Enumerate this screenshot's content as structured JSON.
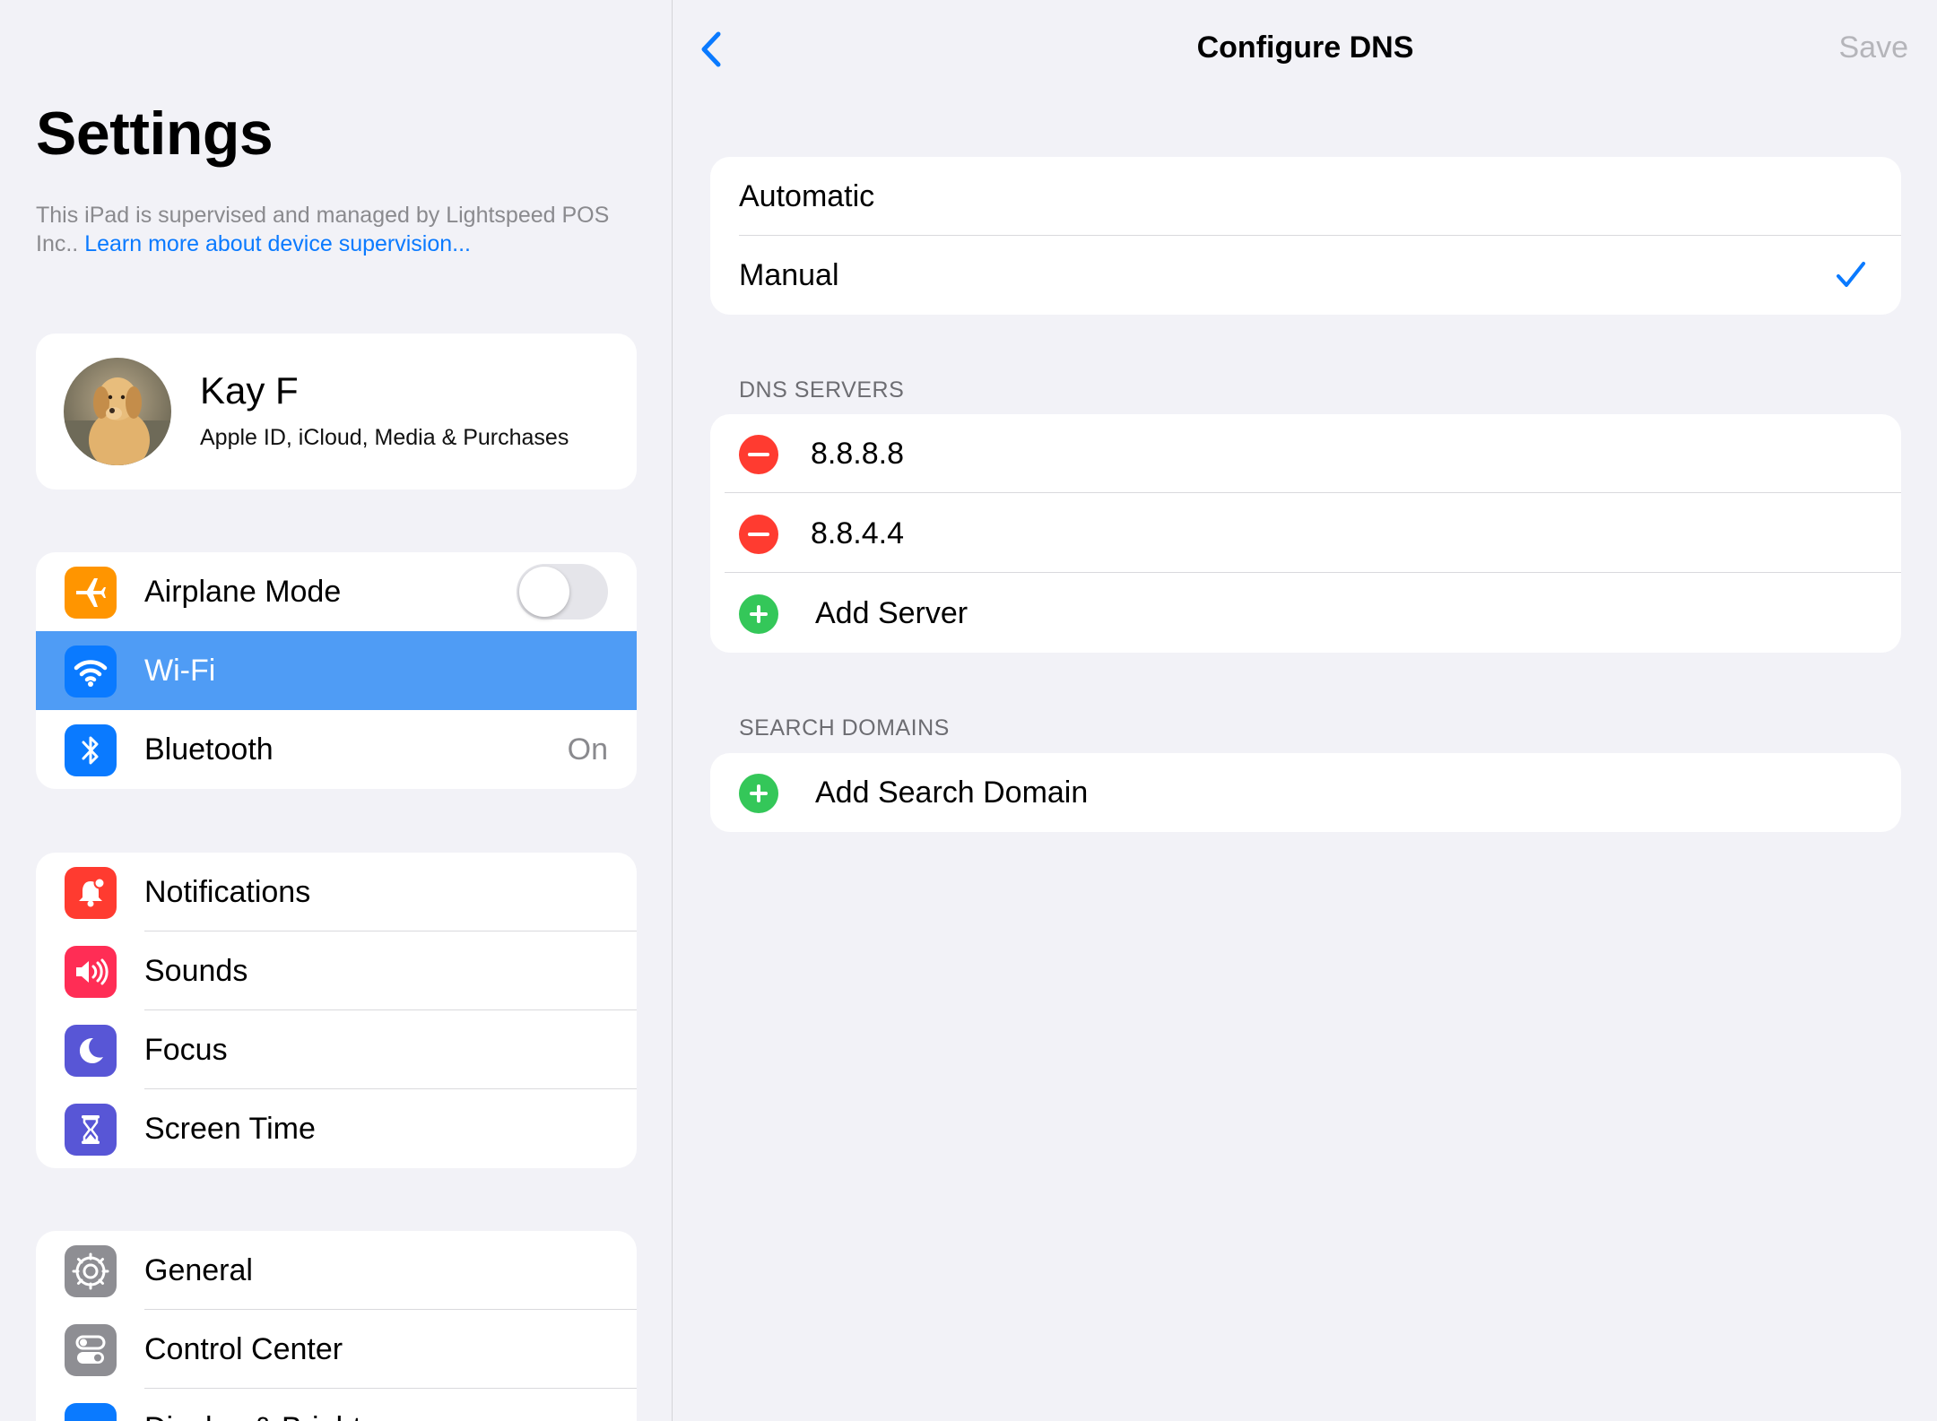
{
  "sidebar": {
    "title": "Settings",
    "supervision_text": "This iPad is supervised and managed by Lightspeed POS Inc..",
    "supervision_link": "Learn more about device supervision...",
    "profile": {
      "name": "Kay F",
      "subtitle": "Apple ID, iCloud, Media & Purchases"
    },
    "group1": [
      {
        "label": "Airplane Mode",
        "icon": "airplane-icon",
        "color": "#ff9500",
        "toggle": false
      },
      {
        "label": "Wi-Fi",
        "icon": "wifi-icon",
        "color": "#0a7aff",
        "selected": true
      },
      {
        "label": "Bluetooth",
        "icon": "bluetooth-icon",
        "color": "#0a7aff",
        "value": "On"
      }
    ],
    "group2": [
      {
        "label": "Notifications",
        "icon": "bell-icon",
        "color": "#ff3b30"
      },
      {
        "label": "Sounds",
        "icon": "speaker-icon",
        "color": "#ff2d55"
      },
      {
        "label": "Focus",
        "icon": "moon-icon",
        "color": "#5856d6"
      },
      {
        "label": "Screen Time",
        "icon": "hourglass-icon",
        "color": "#5856d6"
      }
    ],
    "group3": [
      {
        "label": "General",
        "icon": "gear-icon",
        "color": "#8e8e93"
      },
      {
        "label": "Control Center",
        "icon": "switches-icon",
        "color": "#8e8e93"
      },
      {
        "label": "Display & Brightness",
        "icon": "display-icon",
        "color": "#0a7aff"
      }
    ]
  },
  "detail": {
    "title": "Configure DNS",
    "save_label": "Save",
    "modes": [
      {
        "label": "Automatic",
        "checked": false
      },
      {
        "label": "Manual",
        "checked": true
      }
    ],
    "dns_header": "DNS SERVERS",
    "servers": [
      "8.8.8.8",
      "8.8.4.4"
    ],
    "add_server_label": "Add Server",
    "search_header": "SEARCH DOMAINS",
    "add_domain_label": "Add Search Domain"
  },
  "colors": {
    "accent": "#0a7aff",
    "selected_row": "#4f9cf5",
    "delete": "#ff3b30",
    "add": "#34c759"
  }
}
